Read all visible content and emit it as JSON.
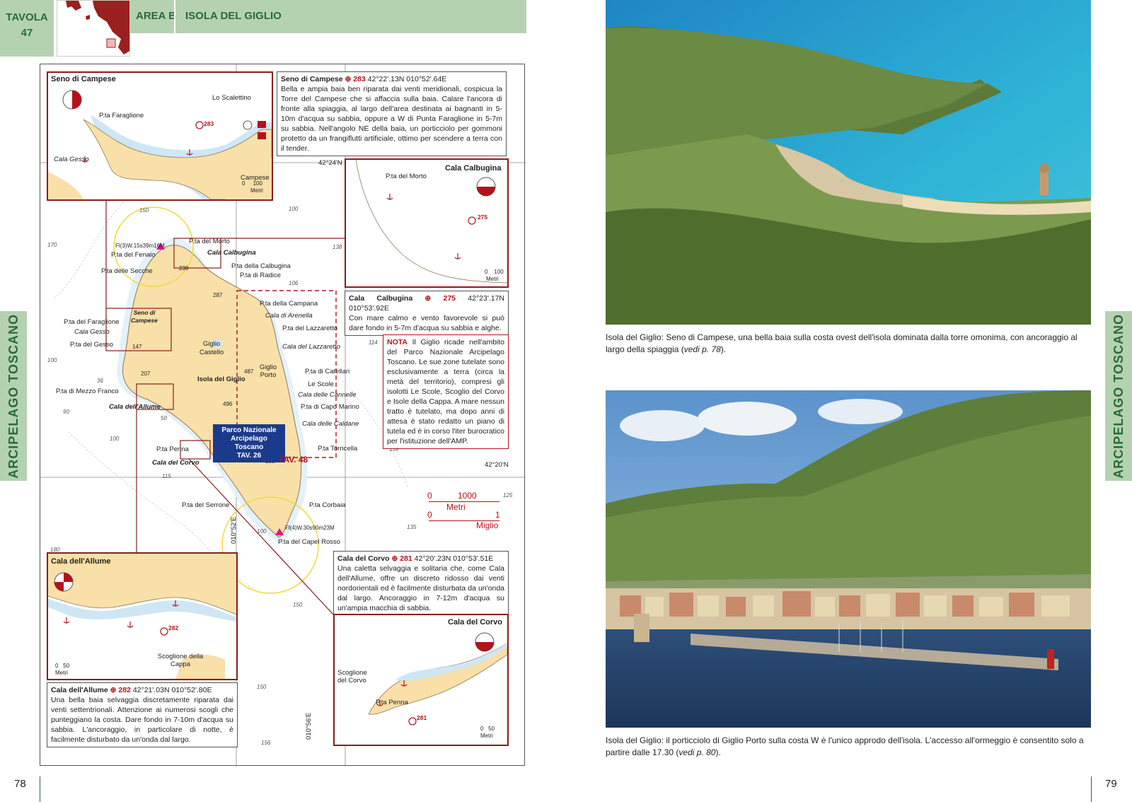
{
  "header": {
    "tavola_label": "TAVOLA",
    "tavola_num": "47",
    "area": "AREA B",
    "title": "ISOLA DEL GIGLIO"
  },
  "side_tab": "ARCIPELAGO TOSCANO",
  "pages": {
    "left": "78",
    "right": "79"
  },
  "chart": {
    "coords": {
      "lat1": "42°24'N",
      "lat2": "42°20'N",
      "lon1": "010°52'E",
      "lon2": "010°56'E"
    },
    "labels": {
      "pta_del_morto": "P.ta del Morto",
      "pta_del_fenaio": "P.ta del Fenaio",
      "cala_calbugina": "Cala Calbugina",
      "pta_della_calbugina": "P.ta della Calbugina",
      "pta_di_radice": "P.ta di Radice",
      "pta_delle_secche": "P.ta delle Secche",
      "fl3": "Fl(3)W.15s39m16M",
      "seno_di_campese": "Seno di Campese",
      "pta_del_faraglione": "P.ta del Faraglione",
      "cala_gesso": "Cala Gesso",
      "pta_del_gesso": "P.ta del Gesso",
      "giglio_castello": "Giglio Castello",
      "isola_del_giglio": "Isola del Giglio",
      "pta_della_campana": "P.ta della Campana",
      "cala_di_arenella": "Cala di Arenella",
      "pta_del_lazzaretto": "P.ta del Lazzaretto",
      "cala_del_lazzaretto": "Cala del Lazzaretto",
      "giglio_porto": "Giglio Porto",
      "pta_di_catellari": "P.ta di Catellari",
      "le_scole": "Le Scole",
      "cala_delle_cannelle": "Cala delle Cannelle",
      "pta_di_capo_marino": "P.ta di Capo Marino",
      "cala_delle_caldane": "Cala delle Caldane",
      "pta_torricella": "P.ta Torricella",
      "pta_di_mezzo_franco": "P.ta di Mezzo Franco",
      "cala_dell_allume": "Cala dell'Allume",
      "pta_penna": "P.ta Penna",
      "cala_del_corvo": "Cala del Corvo",
      "pta_del_serrone": "P.ta del Serrone",
      "pta_corbaia": "P.ta Corbaia",
      "pta_del_capel_rosso": "P.ta del Capel Rosso",
      "fl4": "Fl(4)W.30s90m23M",
      "h238": "238",
      "h287": "287",
      "h147": "147",
      "h207": "207",
      "h487": "487",
      "h496": "496",
      "h388": "388"
    },
    "depths": [
      "150",
      "100",
      "170",
      "138",
      "106",
      "114",
      "132",
      "100",
      "36",
      "90",
      "100",
      "50",
      "115",
      "139",
      "125",
      "135",
      "100",
      "150",
      "150",
      "156",
      "180"
    ],
    "park": {
      "line1": "Parco Nazionale",
      "line2": "Arcipelago Toscano",
      "line3": "TAV. 26"
    },
    "tav48": "TAV. 48",
    "scale": {
      "v0a": "0",
      "v1000": "1000",
      "metri": "Metri",
      "v0b": "0",
      "v1": "1",
      "miglio": "Miglio"
    }
  },
  "insets": {
    "campese": {
      "title": "Seno di Campese",
      "labels": [
        "Lo Scalettino",
        "P.ta Faraglione",
        "Cala Gesso",
        "Campese"
      ],
      "wp": "283",
      "scale": {
        "a": "0",
        "b": "100",
        "unit": "Metri"
      }
    },
    "calbugina": {
      "title": "Cala Calbugina",
      "labels": [
        "P.ta del Morto"
      ],
      "wp": "275",
      "scale": {
        "a": "0",
        "b": "100",
        "unit": "Metri"
      }
    },
    "allume": {
      "title": "Cala dell'Allume",
      "labels": [
        "Scoglione della Cappa"
      ],
      "wp": "282",
      "scale": {
        "a": "0",
        "b": "50",
        "unit": "Metri"
      }
    },
    "corvo": {
      "title": "Cala del Corvo",
      "labels": [
        "Scoglione del Corvo",
        "P.ta Penna"
      ],
      "wp": "281",
      "scale": {
        "a": "0",
        "b": "50",
        "unit": "Metri"
      }
    }
  },
  "infoboxes": {
    "campese": {
      "name": "Seno di Campese",
      "wp": "283",
      "coords": "42°22'.13N 010°52'.64E",
      "text": "Bella e ampia baia ben riparata dai venti meridionali, cospicua la Torre del Campese che si affaccia sulla baia. Calare l'ancora di fronte alla spiaggia, al largo dell'area destinata ai bagnanti in 5-10m d'acqua su sabbia, oppure a W di Punta Faraglione in 5-7m su sabbia. Nell'angolo NE della baia, un porticciolo per gommoni protetto da un frangiflutti artificiale, ottimo per scendere a terra con il tender."
    },
    "calbugina": {
      "name": "Cala Calbugina",
      "wp": "275",
      "coords": "42°23'.17N 010°53'.92E",
      "text": "Con mare calmo e vento favorevole si può dare fondo in 5-7m d'acqua su sabbia e alghe."
    },
    "nota": {
      "label": "NOTA",
      "text": "Il Giglio ricade nell'ambito del Parco Nazionale Arcipelago Toscano. Le sue zone tutelate sono esclusivamente a terra (circa la metà del territorio), compresi gli isolotti Le Scole, Scoglio del Corvo e Isole della Cappa. A mare nessun tratto è tutelato, ma dopo anni di attesa è stato redatto un piano di tutela ed è in corso l'iter burocratico per l'istituzione dell'AMP."
    },
    "corvo": {
      "name": "Cala del Corvo",
      "wp": "281",
      "coords": "42°20'.23N 010°53'.51E",
      "text": "Una caletta selvaggia e solitaria che, come Cala dell'Allume, offre un discreto ridosso dai venti nordorientali ed è facilmente disturbata da un'onda dal largo. Ancoraggio in 7-12m d'acqua su un'ampia macchia di sabbia."
    },
    "allume": {
      "name": "Cala dell'Allume",
      "wp": "282",
      "coords": "42°21'.03N 010°52'.80E",
      "text": "Una bella baia selvaggia discretamente riparata dai venti settentrionali. Attenzione ai numerosi scogli che punteggiano la costa. Dare fondo in 7-10m d'acqua su sabbia. L'ancoraggio, in particolare di notte, è facilmente disturbato da un'onda dal largo."
    }
  },
  "captions": {
    "top": {
      "text": "Isola del Giglio: Seno di Campese, una bella baia sulla costa ovest dell'isola dominata dalla torre omonima, con ancoraggio al largo della spiaggia (",
      "ref": "vedi p. 78",
      "end": ")."
    },
    "bottom": {
      "text": "Isola del Giglio: il porticciolo di Giglio Porto sulla costa W è l'unico approdo dell'isola. L'accesso all'ormeggio è consentito solo a partire dalle 17.30 (",
      "ref": "vedi p. 80",
      "end": ")."
    }
  },
  "colors": {
    "green_tab": "#b5d2b0",
    "green_text": "#2a6a3a",
    "accent_red": "#b4121b",
    "land": "#f8e0a8",
    "sea_shallow": "#cfe6f4"
  }
}
